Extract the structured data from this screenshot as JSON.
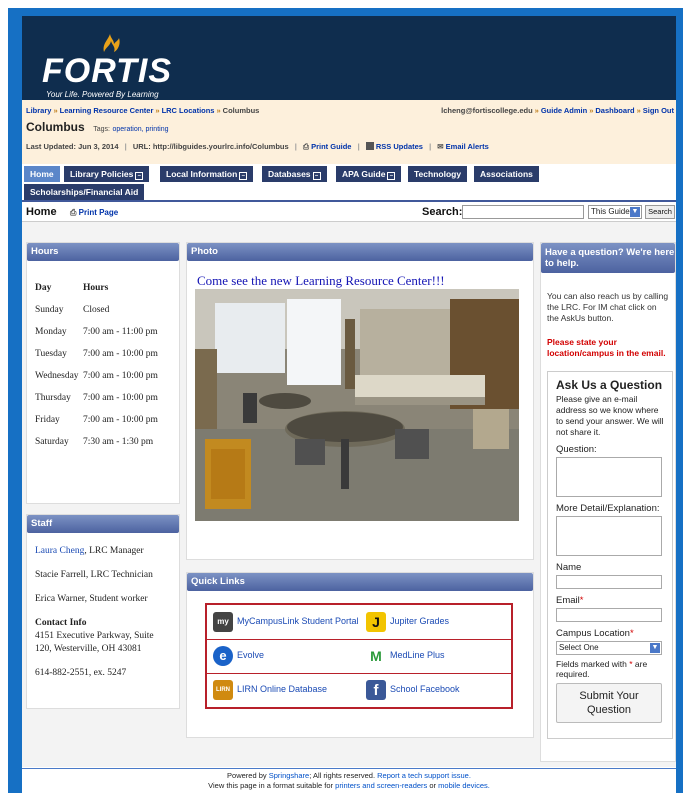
{
  "header": {
    "logo_text": "FORTIS",
    "logo_tagline": "Your Life. Powered By Learning",
    "colors": {
      "header_bg": "#0f2d4e",
      "frame": "#1670c4",
      "accent": "#e8a21a"
    }
  },
  "breadcrumbs": {
    "items": [
      "Library",
      "Learning Resource Center",
      "LRC Locations",
      "Columbus"
    ],
    "separator": "»"
  },
  "user_nav": {
    "email": "lcheng@fortiscollege.edu",
    "links": [
      "Guide Admin",
      "Dashboard",
      "Sign Out"
    ]
  },
  "guide": {
    "title": "Columbus",
    "tags_label": "Tags:",
    "tags": "operation, printing",
    "last_updated": "Last Updated: Jun 3, 2014",
    "url_label": "URL:",
    "url": "http://libguides.yourlrc.info/Columbus",
    "print_guide": "Print Guide",
    "rss_updates": "RSS Updates",
    "email_alerts": "Email Alerts"
  },
  "tabs": [
    {
      "label": "Home",
      "active": true,
      "dropdown": false
    },
    {
      "label": "Library Policies",
      "active": false,
      "dropdown": true
    },
    {
      "label": "Local Information",
      "active": false,
      "dropdown": true
    },
    {
      "label": "Databases",
      "active": false,
      "dropdown": true
    },
    {
      "label": "APA Guide",
      "active": false,
      "dropdown": true
    },
    {
      "label": "Technology",
      "active": false,
      "dropdown": false
    },
    {
      "label": "Associations",
      "active": false,
      "dropdown": false
    },
    {
      "label": "Scholarships/Financial Aid",
      "active": false,
      "dropdown": false
    }
  ],
  "subbar": {
    "page_title": "Home",
    "print_page": "Print Page",
    "search_label": "Search:",
    "search_value": "",
    "scope_value": "This Guide",
    "search_button": "Search"
  },
  "hours": {
    "heading": "Hours",
    "col_day": "Day",
    "col_hours": "Hours",
    "rows": [
      {
        "day": "Sunday",
        "hours": "Closed"
      },
      {
        "day": "Monday",
        "hours": "7:00 am - 11:00 pm"
      },
      {
        "day": "Tuesday",
        "hours": "7:00 am - 10:00 pm"
      },
      {
        "day": "Wednesday",
        "hours": "7:00 am - 10:00 pm"
      },
      {
        "day": "Thursday",
        "hours": "7:00 am - 10:00 pm"
      },
      {
        "day": "Friday",
        "hours": "7:00 am - 10:00 pm"
      },
      {
        "day": "Saturday",
        "hours": "7:30 am - 1:30 pm"
      }
    ]
  },
  "staff": {
    "heading": "Staff",
    "members": [
      {
        "name": "Laura Cheng",
        "role": ", LRC Manager"
      },
      {
        "name": "Stacie Farrell",
        "role": ", LRC Technician"
      },
      {
        "name": "Erica Warner",
        "role": ", Student worker"
      }
    ],
    "contact_heading": "Contact Info",
    "address_line1": "4151 Executive Parkway, Suite",
    "address_line2": "120, Westerville, OH 43081",
    "phone": "614-882-2551, ex. 5247"
  },
  "photo": {
    "heading": "Photo",
    "caption": "Come see the new Learning Resource Center!!!"
  },
  "quick_links": {
    "heading": "Quick Links",
    "items": [
      {
        "label": "MyCampusLink Student Portal",
        "icon": "mycampuslink-icon",
        "color": "#444444"
      },
      {
        "label": "Jupiter Grades",
        "icon": "jupiter-grades-icon",
        "color": "#f2c400"
      },
      {
        "label": "Evolve",
        "icon": "evolve-icon",
        "color": "#1a62c8"
      },
      {
        "label": "MedLine Plus",
        "icon": "medline-plus-icon",
        "color": "#2a9a3a"
      },
      {
        "label": "LIRN Online Database",
        "icon": "lirn-icon",
        "color": "#d08a10"
      },
      {
        "label": "School Facebook",
        "icon": "facebook-icon",
        "color": "#3b5998"
      }
    ]
  },
  "sidebar": {
    "heading": "Have a question? We're here to help.",
    "intro": "You can also reach us by calling the LRC.  For IM chat click on the AskUs button.",
    "notice": "Please state your location/campus in the email.",
    "ask_title": "Ask Us a Question",
    "ask_text": "Please give an e-mail address so we know where to send your answer. We will not share it.",
    "question_label": "Question:",
    "detail_label": "More Detail/Explanation:",
    "name_label": "Name",
    "email_label": "Email",
    "campus_label": "Campus Location",
    "campus_value": "Select One",
    "required_note_prefix": "Fields marked with",
    "required_note_suffix": "are required.",
    "required_mark": "*",
    "submit_label": "Submit Your Question"
  },
  "footer": {
    "line1_prefix": "Powered by",
    "springshare": "Springshare",
    "line1_mid": "; All rights reserved.",
    "report_issue": "Report a tech support issue.",
    "line2_prefix": "View this page in a format suitable for",
    "printers": "printers and screen-readers",
    "or": "or",
    "mobile": "mobile devices."
  }
}
